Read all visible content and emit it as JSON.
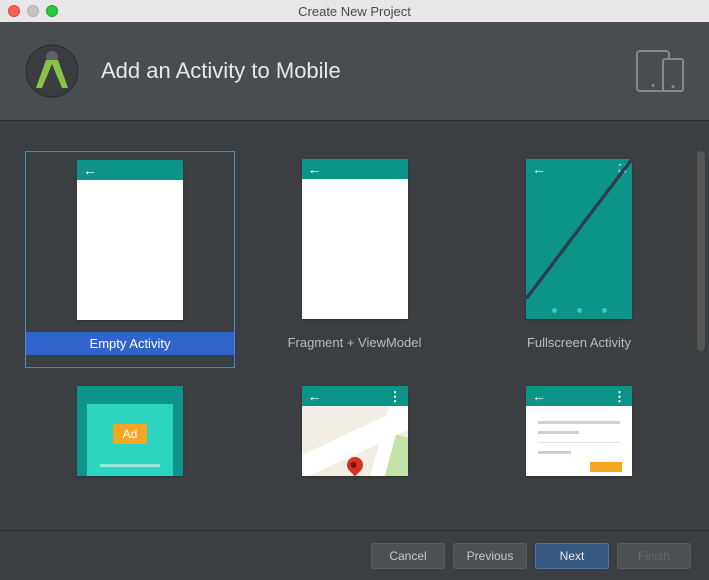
{
  "window": {
    "title": "Create New Project"
  },
  "header": {
    "title": "Add an Activity to Mobile"
  },
  "activities": {
    "row1": [
      {
        "label": "Empty Activity",
        "selected": true
      },
      {
        "label": "Fragment + ViewModel",
        "selected": false
      },
      {
        "label": "Fullscreen Activity",
        "selected": false
      }
    ],
    "ad_badge": "Ad"
  },
  "footer": {
    "cancel": "Cancel",
    "previous": "Previous",
    "next": "Next",
    "finish": "Finish"
  }
}
